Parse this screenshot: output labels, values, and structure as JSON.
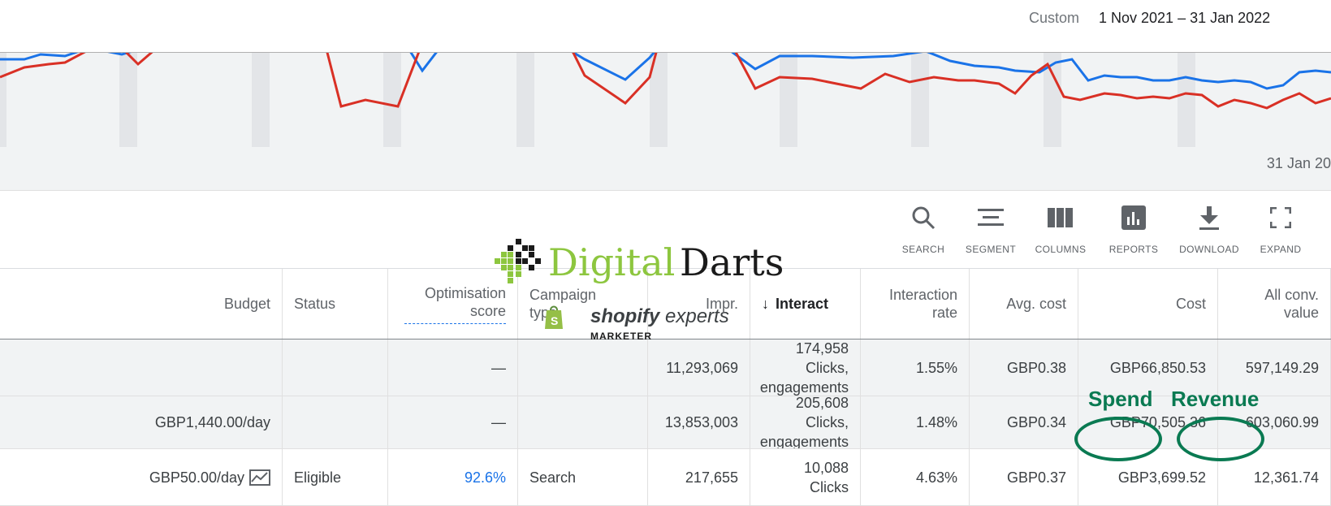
{
  "date_bar": {
    "label": "Custom",
    "range": "1 Nov 2021 – 31 Jan 2022"
  },
  "chart": {
    "x_end_label": "31 Jan 20",
    "line_colors": [
      "#1a73e8",
      "#d93025"
    ]
  },
  "toolbar": [
    {
      "label": "SEARCH",
      "icon": "search-icon"
    },
    {
      "label": "SEGMENT",
      "icon": "segment-icon"
    },
    {
      "label": "COLUMNS",
      "icon": "columns-icon"
    },
    {
      "label": "REPORTS",
      "icon": "reports-icon"
    },
    {
      "label": "DOWNLOAD",
      "icon": "download-icon"
    },
    {
      "label": "EXPAND",
      "icon": "expand-icon"
    }
  ],
  "table": {
    "headers": {
      "budget": "Budget",
      "status": "Status",
      "optimisation": "Optimisation score",
      "campaign_type": "Campaign type",
      "impr": "Impr.",
      "interactions": "Interact",
      "interaction_rate": "Interaction rate",
      "avg_cost": "Avg. cost",
      "cost": "Cost",
      "all_conv": "All conv. value"
    },
    "rows": [
      {
        "budget": "",
        "status": "",
        "optimisation": "—",
        "campaign_type": "",
        "impr": "11,293,069",
        "interactions": "174,958 Clicks, engagements",
        "interaction_rate": "1.55%",
        "avg_cost": "GBP0.38",
        "cost": "GBP66,850.53",
        "all_conv": "597,149.29"
      },
      {
        "budget": "GBP1,440.00/day",
        "status": "",
        "optimisation": "—",
        "campaign_type": "",
        "impr": "13,853,003",
        "interactions": "205,608 Clicks, engagements",
        "interaction_rate": "1.48%",
        "avg_cost": "GBP0.34",
        "cost": "GBP70,505.36",
        "all_conv": "603,060.99"
      },
      {
        "budget": "GBP50.00/day",
        "status": "Eligible",
        "optimisation": "92.6%",
        "campaign_type": "Search",
        "impr": "217,655",
        "interactions": "10,088 Clicks",
        "interaction_rate": "4.63%",
        "avg_cost": "GBP0.37",
        "cost": "GBP3,699.52",
        "all_conv": "12,361.74"
      }
    ]
  },
  "watermark": {
    "brand_part1": "Digital",
    "brand_part2": "Darts",
    "shopify_bold": "shopify",
    "shopify_rest": " experts",
    "shopify_sub": "MARKETER",
    "colors": {
      "green": "#8dc63f",
      "shopify_green": "#95bf47"
    }
  },
  "annotations": {
    "spend": "Spend",
    "revenue": "Revenue",
    "color": "#0a7a52"
  }
}
